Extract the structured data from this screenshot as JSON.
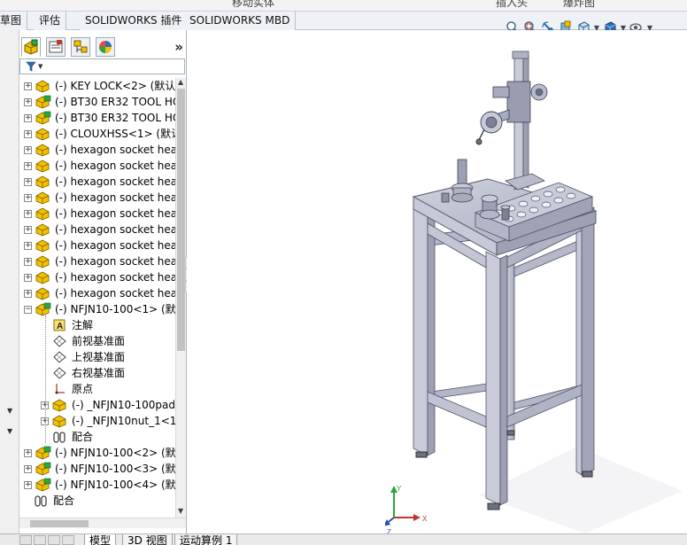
{
  "top_strip": {
    "fragments": [
      "移动实体",
      "插入头",
      "爆炸图"
    ]
  },
  "command_tabs": [
    {
      "label": "草图"
    },
    {
      "label": "评估"
    },
    {
      "label": "SOLIDWORKS 插件"
    },
    {
      "label": "SOLIDWORKS MBD"
    }
  ],
  "feature_manager": {
    "expand_symbol": "»",
    "tabs": [
      "feature-tree",
      "property-manager",
      "configuration-manager",
      "display-manager"
    ]
  },
  "tree": {
    "items": [
      {
        "label": "(-) KEY LOCK<2> (默认",
        "icon": "part-icon",
        "level": 0,
        "expander": "+"
      },
      {
        "label": "(-) BT30 ER32 TOOL HO",
        "icon": "part-icon-green",
        "level": 0,
        "expander": "+"
      },
      {
        "label": "(-) BT30 ER32 TOOL HO",
        "icon": "part-icon-green",
        "level": 0,
        "expander": "+"
      },
      {
        "label": "(-) CLOUXHSS<1> (默认",
        "icon": "part-icon",
        "level": 0,
        "expander": "+"
      },
      {
        "label": "(-) hexagon socket hea",
        "icon": "part-icon",
        "level": 0,
        "expander": "+"
      },
      {
        "label": "(-) hexagon socket hea",
        "icon": "part-icon",
        "level": 0,
        "expander": "+"
      },
      {
        "label": "(-) hexagon socket hea",
        "icon": "part-icon",
        "level": 0,
        "expander": "+"
      },
      {
        "label": "(-) hexagon socket hea",
        "icon": "part-icon",
        "level": 0,
        "expander": "+"
      },
      {
        "label": "(-) hexagon socket hea",
        "icon": "part-icon",
        "level": 0,
        "expander": "+"
      },
      {
        "label": "(-) hexagon socket hea",
        "icon": "part-icon",
        "level": 0,
        "expander": "+"
      },
      {
        "label": "(-) hexagon socket hea",
        "icon": "part-icon",
        "level": 0,
        "expander": "+"
      },
      {
        "label": "(-) hexagon socket hea",
        "icon": "part-icon",
        "level": 0,
        "expander": "+"
      },
      {
        "label": "(-) hexagon socket hea",
        "icon": "part-icon",
        "level": 0,
        "expander": "+"
      },
      {
        "label": "(-) hexagon socket hea",
        "icon": "part-icon",
        "level": 0,
        "expander": "+"
      },
      {
        "label": "(-) NFJN10-100<1> (默",
        "icon": "assembly-icon",
        "level": 0,
        "expander": "−"
      },
      {
        "label": "注解",
        "icon": "annotation-icon",
        "level": 1,
        "expander": ""
      },
      {
        "label": "前视基准面",
        "icon": "plane-icon",
        "level": 1,
        "expander": ""
      },
      {
        "label": "上视基准面",
        "icon": "plane-icon",
        "level": 1,
        "expander": ""
      },
      {
        "label": "右视基准面",
        "icon": "plane-icon",
        "level": 1,
        "expander": ""
      },
      {
        "label": "原点",
        "icon": "origin-icon",
        "level": 1,
        "expander": ""
      },
      {
        "label": "(-) _NFJN10-100pad",
        "icon": "part-icon",
        "level": 1,
        "expander": "+"
      },
      {
        "label": "(-) _NFJN10nut_1<1",
        "icon": "part-icon",
        "level": 1,
        "expander": "+"
      },
      {
        "label": "配合",
        "icon": "mate-icon",
        "level": 1,
        "expander": ""
      },
      {
        "label": "(-) NFJN10-100<2> (默",
        "icon": "assembly-icon",
        "level": 0,
        "expander": "+"
      },
      {
        "label": "(-) NFJN10-100<3> (默",
        "icon": "assembly-icon",
        "level": 0,
        "expander": "+"
      },
      {
        "label": "(-) NFJN10-100<4> (默",
        "icon": "assembly-icon",
        "level": 0,
        "expander": "+"
      },
      {
        "label": "配合",
        "icon": "mate-icon",
        "level": -1,
        "expander": ""
      }
    ]
  },
  "bottom_tabs": [
    {
      "label": "模型",
      "active": true
    },
    {
      "label": "3D 视图",
      "active": false
    },
    {
      "label": "运动算例 1",
      "active": false
    }
  ],
  "triad": {
    "x_label": "X",
    "y_label": "Y",
    "z_label": "Z"
  },
  "hud_icons": [
    "zoom-to-fit-icon",
    "zoom-area-icon",
    "previous-view-icon",
    "section-view-icon",
    "view-orientation-icon",
    "display-style-icon",
    "hide-show-icon"
  ],
  "colors": {
    "accent_tab": "#eef1f5",
    "part_yellow": "#f2c200",
    "part_green": "#2aa83a",
    "machine_body": "#b9bccb"
  }
}
